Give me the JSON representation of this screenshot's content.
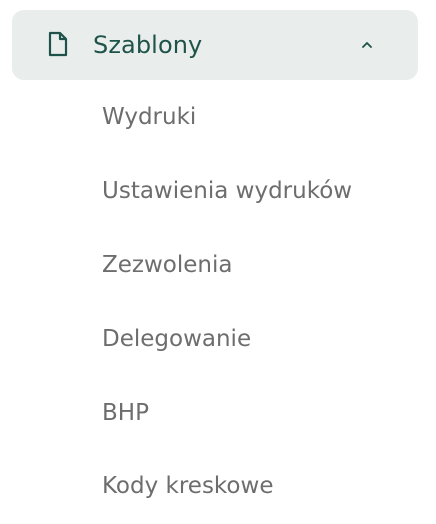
{
  "section": {
    "label": "Szablony",
    "icon": "document-icon",
    "expand_icon": "chevron-up-icon",
    "expanded": true,
    "accent_color": "#1f5349",
    "header_background": "#e9eeed"
  },
  "items": [
    {
      "label": "Wydruki"
    },
    {
      "label": "Ustawienia wydruków"
    },
    {
      "label": "Zezwolenia"
    },
    {
      "label": "Delegowanie"
    },
    {
      "label": "BHP"
    },
    {
      "label": "Kody kreskowe"
    }
  ],
  "item_text_color": "#6d6d6d"
}
